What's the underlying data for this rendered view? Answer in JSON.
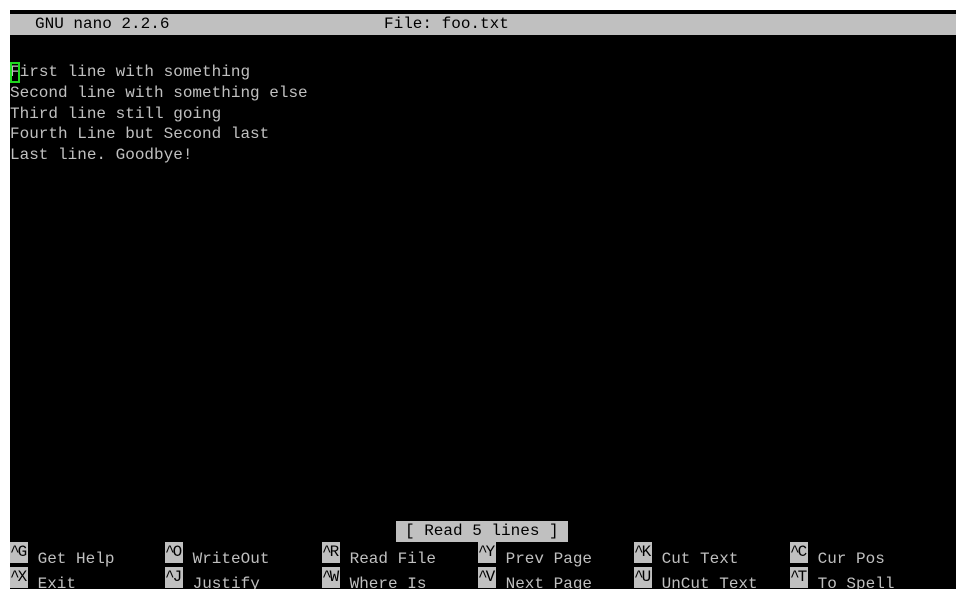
{
  "title": {
    "version": "GNU nano 2.2.6",
    "file": "File: foo.txt"
  },
  "editor": {
    "cursor_char": "F",
    "lines": [
      "irst line with something",
      "Second line with something else",
      "Third line still going",
      "Fourth Line but Second last",
      "Last line. Goodbye!"
    ]
  },
  "status": "[ Read 5 lines ]",
  "shortcuts": [
    {
      "key": "^G",
      "label": " Get Help"
    },
    {
      "key": "^O",
      "label": " WriteOut"
    },
    {
      "key": "^R",
      "label": " Read File"
    },
    {
      "key": "^Y",
      "label": " Prev Page"
    },
    {
      "key": "^K",
      "label": " Cut Text"
    },
    {
      "key": "^C",
      "label": " Cur Pos"
    },
    {
      "key": "^X",
      "label": " Exit"
    },
    {
      "key": "^J",
      "label": " Justify"
    },
    {
      "key": "^W",
      "label": " Where Is"
    },
    {
      "key": "^V",
      "label": " Next Page"
    },
    {
      "key": "^U",
      "label": " UnCut Text"
    },
    {
      "key": "^T",
      "label": " To Spell"
    }
  ],
  "colors": {
    "background": "#000000",
    "text": "#c0c0c0",
    "bar": "#c0c0c0",
    "cursor": "#1fd81f"
  }
}
